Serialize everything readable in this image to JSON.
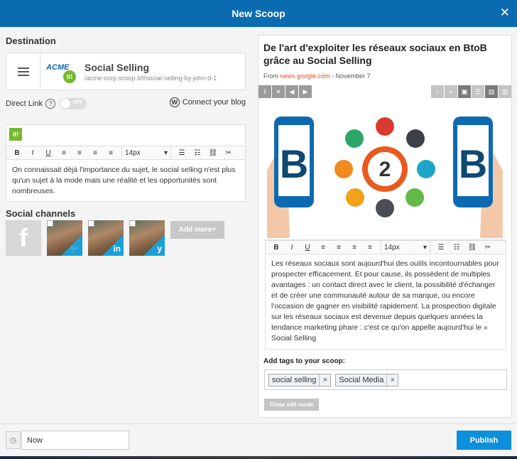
{
  "header": {
    "title": "New Scoop",
    "close": "✕"
  },
  "destination": {
    "heading": "Destination",
    "logo_text": "ACME",
    "logo_badge": "it!",
    "name": "Social Selling",
    "url": "/acme-corp.scoop.it/t/social-selling-by-john-d-1"
  },
  "direct_link": {
    "label": "Direct Link",
    "help": "?",
    "toggle": "OFF"
  },
  "blog": {
    "icon": "W",
    "label": "Connect your blog"
  },
  "left_editor": {
    "badge": "it!",
    "toolbar": {
      "bold": "B",
      "italic": "I",
      "underline": "U",
      "size": "14px"
    },
    "text": "On connaissait déjà l'importance du sujet, le social selling n'est plus qu'un sujet à la mode mais une réalité et les opportunités sont nombreuses."
  },
  "social": {
    "heading": "Social channels",
    "channels": [
      {
        "name": "facebook",
        "glyph": "f"
      },
      {
        "name": "twitter",
        "glyph": "🐦"
      },
      {
        "name": "linkedin",
        "glyph": "in"
      },
      {
        "name": "yammer",
        "glyph": "y"
      }
    ],
    "add_more": "Add more+"
  },
  "article": {
    "title": "De l'art d'exploiter les réseaux sociaux en BtoB grâce au Social Selling",
    "from": "From",
    "source": "news.google.com",
    "date": "- November 7",
    "image_letters": {
      "left": "B",
      "center": "2",
      "right": "B"
    },
    "toolbar": {
      "bold": "B",
      "italic": "I",
      "underline": "U",
      "size": "14px"
    },
    "text": "Les réseaux sociaux sont aujourd'hui des outils incontournables pour prospecter efficacement. Et pour cause, ils possèdent de multiples avantages : un contact direct avec le client, la possibilité d'échanger et de créer une communauté autour de sa marque, ou encore l'occasion de gagner en visibilité rapidement. La prospection digitale sur les réseaux sociaux est devenue depuis quelques années la tendance marketing phare : c'est ce qu'on appelle aujourd'hui le « Social Selling"
  },
  "tags": {
    "heading": "Add tags to your scoop:",
    "items": [
      "social selling",
      "Social Media"
    ],
    "remove": "×"
  },
  "close_edit": "Close edit mode",
  "footer": {
    "time": "Now",
    "publish": "Publish"
  },
  "colors": {
    "header": "#0b6bb0",
    "publish": "#0d8fdb",
    "scoopit_green": "#74b82c",
    "source_link": "#e54c1d"
  }
}
